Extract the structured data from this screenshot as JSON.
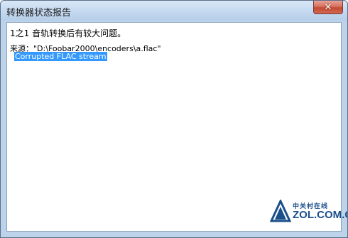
{
  "window": {
    "title": "转换器状态报告",
    "close_label": "✕"
  },
  "report": {
    "summary": "1之1 音轨转换后有较大问题。",
    "source_label": "来源：",
    "source_path": "\"D:\\Foobar2000\\encoders\\a.flac\"",
    "error_selected": "Corrupted FLAC stream"
  },
  "watermark": {
    "cn_text": "中关村在线",
    "en_text": "ZOL.COM.CN",
    "icon": "zol-logo-icon"
  },
  "colors": {
    "title_bar": "#c7dbf1",
    "close_button": "#c34a33",
    "selection": "#3399ff",
    "watermark": "#1a4f8a"
  }
}
